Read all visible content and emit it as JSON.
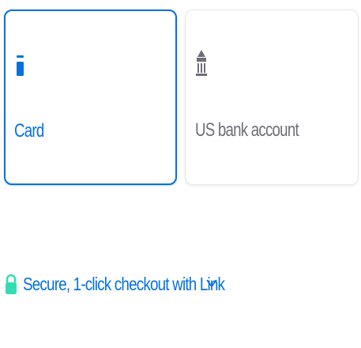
{
  "payment_tabs": [
    {
      "label": "Card",
      "icon": "card-icon",
      "selected": true
    },
    {
      "label": "US bank account",
      "icon": "bank-icon",
      "selected": false
    }
  ],
  "link": {
    "text": "Secure, 1-click checkout with Link",
    "icon": "lock-icon",
    "expand_icon": "chevron-down-icon"
  },
  "colors": {
    "accent": "#0570de",
    "muted": "#6d6e78",
    "lock_green": "#33ddb3",
    "tab_border": "#e6e6e6"
  }
}
